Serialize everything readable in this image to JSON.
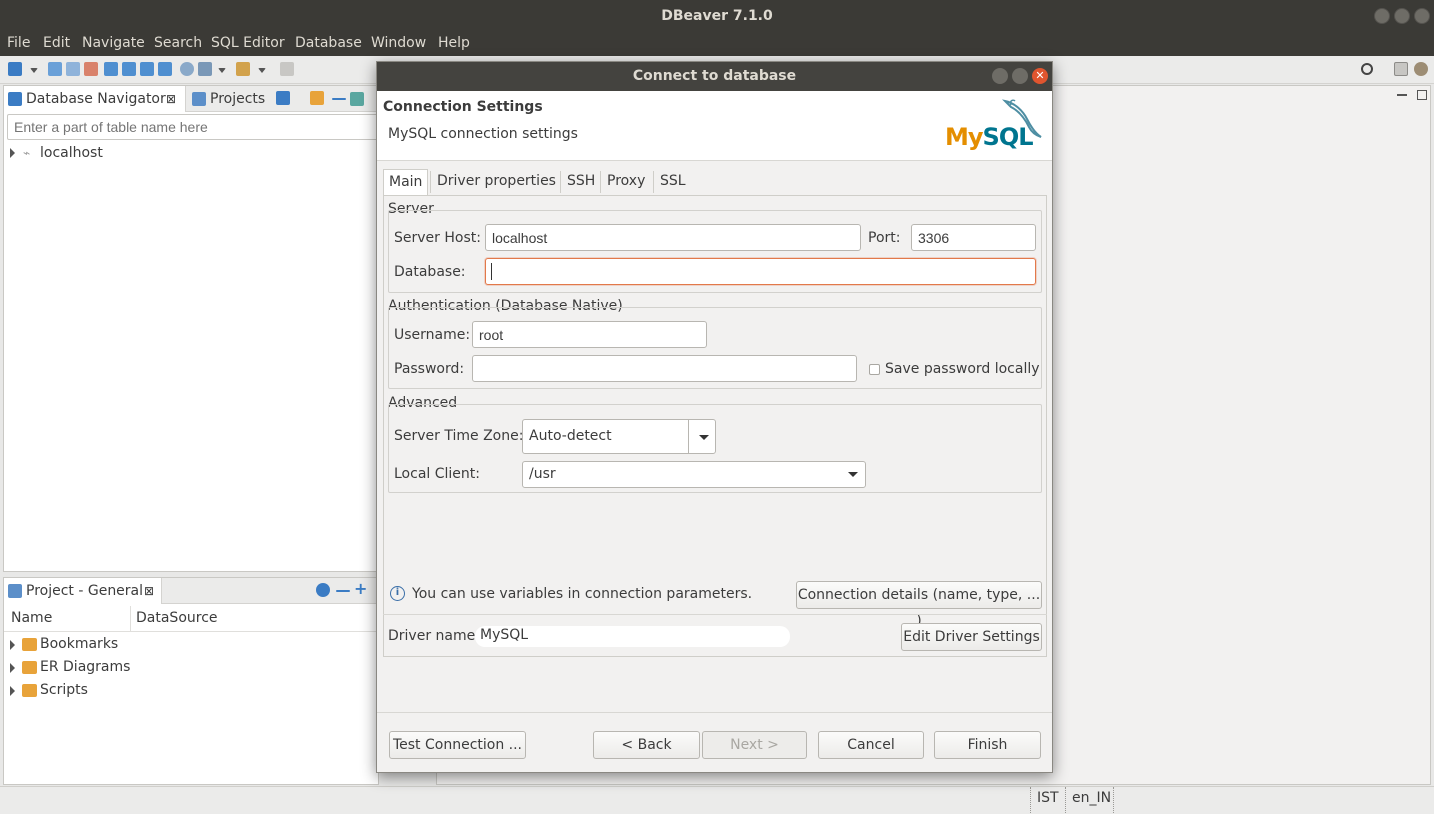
{
  "app": {
    "title": "DBeaver 7.1.0"
  },
  "menu": [
    "File",
    "Edit",
    "Navigate",
    "Search",
    "SQL Editor",
    "Database",
    "Window",
    "Help"
  ],
  "navigator": {
    "tab_label": "Database Navigator",
    "projects_tab_label": "Projects",
    "filter_placeholder": "Enter a part of table name here",
    "tree": [
      {
        "label": "localhost"
      }
    ]
  },
  "project_panel": {
    "tab_label": "Project - General",
    "columns": [
      "Name",
      "DataSource"
    ],
    "items": [
      "Bookmarks",
      "ER Diagrams",
      "Scripts"
    ]
  },
  "status": {
    "timezone": "IST",
    "locale": "en_IN"
  },
  "dialog": {
    "title": "Connect to database",
    "header_title": "Connection Settings",
    "header_subtitle": "MySQL connection settings",
    "logo_text": "MySQL",
    "tabs": [
      "Main",
      "Driver properties",
      "SSH",
      "Proxy",
      "SSL"
    ],
    "server_group": "Server",
    "host_label": "Server Host:",
    "host_value": "localhost",
    "port_label": "Port:",
    "port_value": "3306",
    "database_label": "Database:",
    "database_value": "",
    "auth_group": "Authentication (Database Native)",
    "username_label": "Username:",
    "username_value": "root",
    "password_label": "Password:",
    "password_value": "",
    "save_password_label": "Save password locally",
    "advanced_group": "Advanced",
    "timezone_label": "Server Time Zone:",
    "timezone_value": "Auto-detect",
    "local_client_label": "Local Client:",
    "local_client_value": "/usr",
    "info_text": "You can use variables in connection parameters.",
    "conn_details_button": "Connection details (name, type, ... )",
    "driver_name_label": "Driver name:",
    "driver_name_value": "MySQL",
    "edit_driver_button": "Edit Driver Settings",
    "test_button": "Test Connection ...",
    "back_button": "< Back",
    "next_button": "Next >",
    "cancel_button": "Cancel",
    "finish_button": "Finish"
  }
}
